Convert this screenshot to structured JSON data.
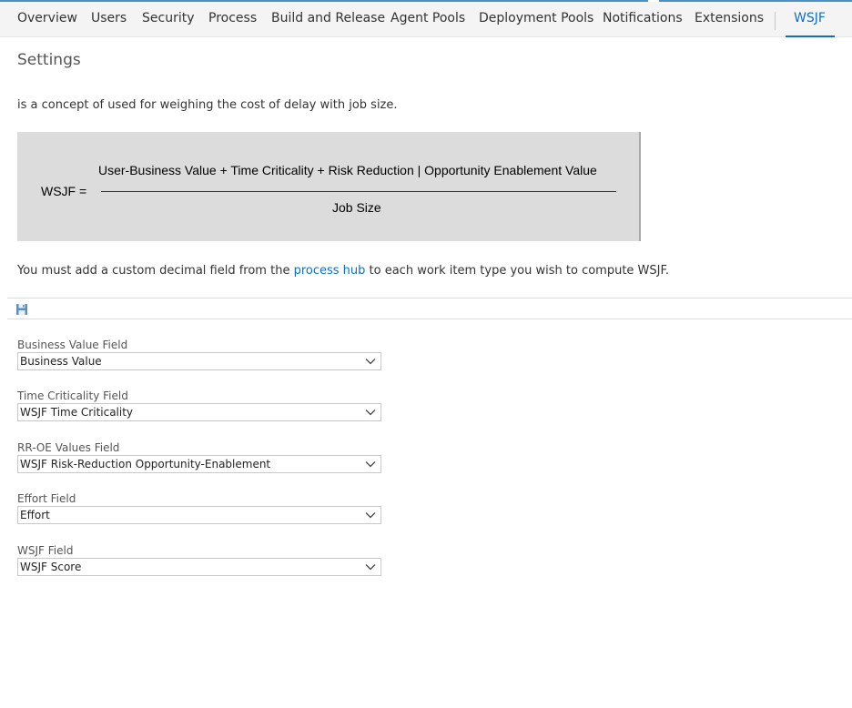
{
  "tabs": [
    {
      "label": "Overview"
    },
    {
      "label": "Users"
    },
    {
      "label": "Security"
    },
    {
      "label": "Process"
    },
    {
      "label": "Build and Release"
    },
    {
      "label": "Agent Pools"
    },
    {
      "label": "Deployment Pools"
    },
    {
      "label": "Notifications"
    },
    {
      "label": "Extensions"
    },
    {
      "label": "WSJF",
      "active": true
    }
  ],
  "page": {
    "title": "Settings",
    "intro": "is a concept of used for weighing the cost of delay with job size."
  },
  "formula": {
    "lhs": "WSJF =",
    "numerator": "User-Business Value + Time Criticality  + Risk Reduction | Opportunity Enablement Value",
    "denominator": "Job Size"
  },
  "note": {
    "before": "You must add a custom decimal field from the ",
    "link": "process hub",
    "after": " to each work item type you wish to compute WSJF."
  },
  "toolbar": {
    "save_icon": "save-icon"
  },
  "fields": [
    {
      "label": "Business Value Field",
      "value": "Business Value"
    },
    {
      "label": "Time Criticality Field",
      "value": "WSJF Time Criticality"
    },
    {
      "label": "RR-OE Values Field",
      "value": "WSJF Risk-Reduction Opportunity-Enablement"
    },
    {
      "label": "Effort Field",
      "value": "Effort"
    },
    {
      "label": "WSJF Field",
      "value": "WSJF Score"
    }
  ],
  "colors": {
    "accent": "#106ebe",
    "formula_bg": "#dcdcdc",
    "tab_bg": "#f4f4f4"
  }
}
